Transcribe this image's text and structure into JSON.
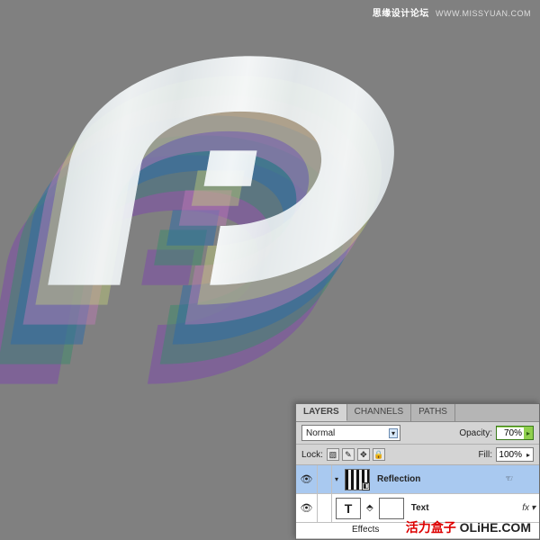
{
  "watermark_top": {
    "cn": "思缘设计论坛",
    "en": "WWW.MISSYUAN.COM"
  },
  "watermark_bottom": {
    "red": "活力盒子",
    "rest": " OLiHE.COM"
  },
  "panel": {
    "tabs": {
      "layers": "LAYERS",
      "channels": "CHANNELS",
      "paths": "PATHS"
    },
    "blend_mode": "Normal",
    "opacity_label": "Opacity:",
    "opacity_value": "70%",
    "lock_label": "Lock:",
    "fill_label": "Fill:",
    "fill_value": "100%",
    "layers": [
      {
        "name": "Reflection",
        "type_glyph": ""
      },
      {
        "name": "Text",
        "type_glyph": "T",
        "effects_label": "Effects",
        "fx": "fx"
      }
    ]
  }
}
